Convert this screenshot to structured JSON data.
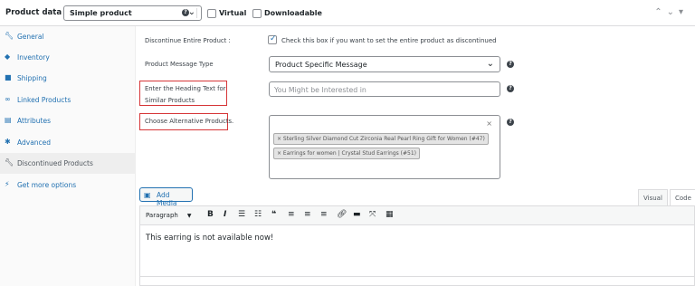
{
  "header": {
    "title": "Product data —",
    "product_type": "Simple product",
    "virtual_label": "Virtual",
    "downloadable_label": "Downloadable"
  },
  "sidebar": {
    "items": [
      {
        "label": "General",
        "icon": "wrench-icon"
      },
      {
        "label": "Inventory",
        "icon": "tag-icon"
      },
      {
        "label": "Shipping",
        "icon": "truck-icon"
      },
      {
        "label": "Linked Products",
        "icon": "link-icon"
      },
      {
        "label": "Attributes",
        "icon": "list-icon"
      },
      {
        "label": "Advanced",
        "icon": "gear-icon"
      },
      {
        "label": "Discontinued Products",
        "icon": "wrench-icon"
      },
      {
        "label": "Get more options",
        "icon": "plugin-icon"
      }
    ],
    "active_index": 6
  },
  "form": {
    "discontinue_label": "Discontinue Entire Product :",
    "discontinue_text": "Check this box if you want to set the entire product as discontinued",
    "discontinue_checked": true,
    "message_type_label": "Product Message Type",
    "message_type_value": "Product Specific Message",
    "heading_label_line1": "Enter the Heading Text for",
    "heading_label_line2": "Similar Products",
    "heading_placeholder": "You Might be Interested in",
    "alt_products_label": "Choose Alternative Products.",
    "alt_products": [
      "× Sterling Silver Diamond Cut Zirconia Real Pearl Ring Gift for Women (#47)",
      "× Earrings for women | Crystal Stud Earrings (#51)"
    ],
    "clear_symbol": "×"
  },
  "editor": {
    "add_media": "Add Media",
    "tab_visual": "Visual",
    "tab_code": "Code",
    "format": "Paragraph",
    "content": "This earring is not available now!"
  },
  "colors": {
    "accent": "#2271b1",
    "highlight_border": "#d63638"
  }
}
